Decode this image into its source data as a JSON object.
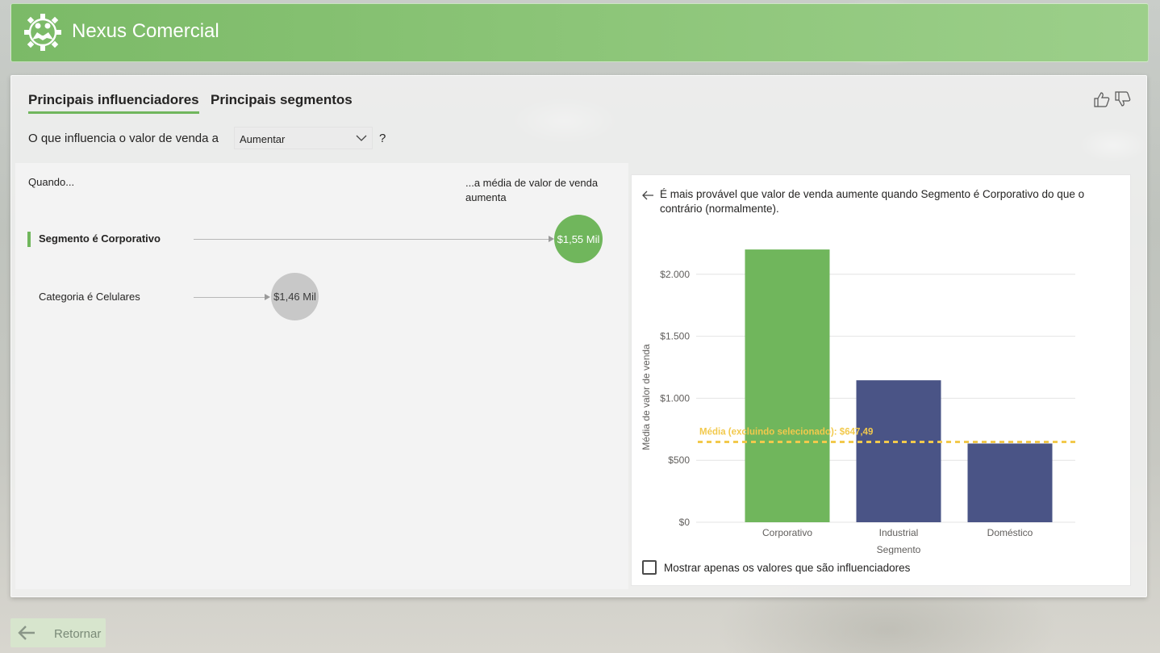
{
  "app": {
    "title": "Nexus Comercial",
    "logo_icon": "handshake-gear-icon"
  },
  "tabs": [
    {
      "label": "Principais influenciadores",
      "active": true
    },
    {
      "label": "Principais segmentos",
      "active": false
    }
  ],
  "feedback": {
    "like_icon": "thumbs-up-icon",
    "dislike_icon": "thumbs-down-icon"
  },
  "question": {
    "prefix": "O que influencia o valor de venda a",
    "dropdown_value": "Aumentar",
    "suffix": "?"
  },
  "influencers": {
    "when_label": "Quando...",
    "avg_label": "...a média de valor de venda aumenta",
    "items": [
      {
        "label": "Segmento é Corporativo",
        "value": "$1,55 Mil",
        "selected": true
      },
      {
        "label": "Categoria é Celulares",
        "value": "$1,46 Mil",
        "selected": false
      }
    ]
  },
  "detail": {
    "description": "É mais provável que valor de venda aumente quando Segmento é Corporativo do que o contrário (normalmente).",
    "checkbox_label": "Mostrar apenas os valores que são influenciadores",
    "checkbox_checked": false
  },
  "chart_data": {
    "type": "bar",
    "categories": [
      "Corporativo",
      "Industrial",
      "Doméstico"
    ],
    "values": [
      2200,
      1145,
      635
    ],
    "colors": [
      "#70b65c",
      "#4a5486",
      "#4a5486"
    ],
    "xlabel": "Segmento",
    "ylabel": "Média de valor de venda",
    "yticks": [
      "$0",
      "$500",
      "$1.000",
      "$1.500",
      "$2.000"
    ],
    "ytick_values": [
      0,
      500,
      1000,
      1500,
      2000
    ],
    "ylim": [
      0,
      2500
    ],
    "reference_line": {
      "label": "Média (excluindo selecionado): $647,49",
      "value": 647.49,
      "color": "#f2c94c"
    }
  },
  "footer": {
    "back_label": "Retornar",
    "back_icon": "arrow-left-icon"
  }
}
